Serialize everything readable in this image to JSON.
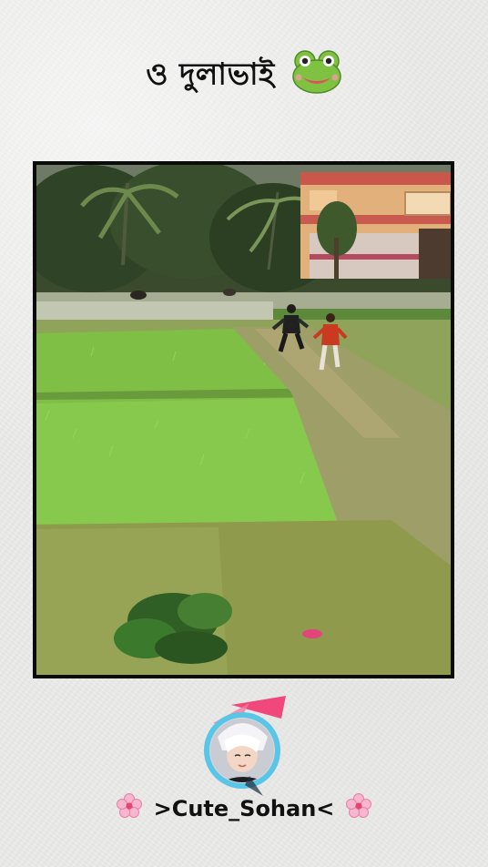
{
  "caption": {
    "text": "ও দুলাভাই",
    "emoji_icon": "frog-face-icon"
  },
  "video": {
    "scene": "rice-field-chase"
  },
  "profile": {
    "avatar_icon": "anime-avatar-icon",
    "username": ">Cute_Sohan<",
    "left_decoration_icon": "cherry-blossom-icon",
    "right_decoration_icon": "cherry-blossom-icon"
  },
  "colors": {
    "background": "#ececeb",
    "frame_border": "#0b0b0b",
    "text": "#111111",
    "avatar_ring": "#59c6e8",
    "accent_pink": "#f0477d"
  }
}
